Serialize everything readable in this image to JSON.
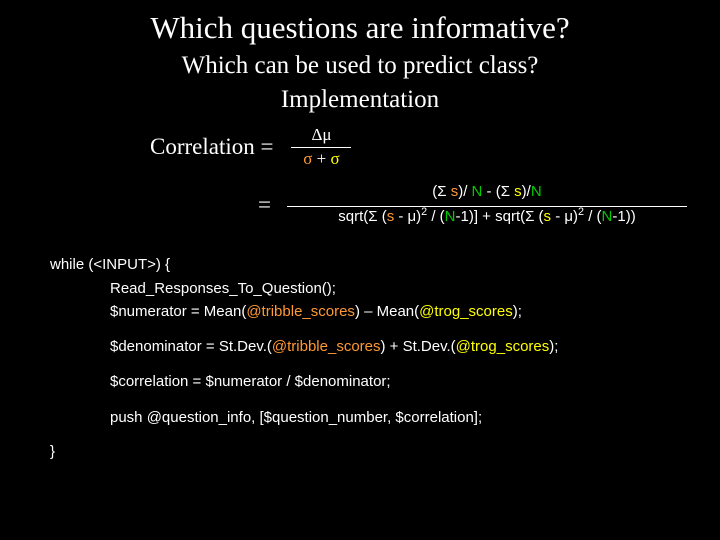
{
  "title": "Which questions are informative?",
  "subtitle": "Which can be used to predict class?",
  "impl": "Implementation",
  "eq1": {
    "lhs": "Correlation =",
    "num": "Δμ",
    "den_sigma1": "σ",
    "den_plus": " + ",
    "den_sigma2": "σ"
  },
  "eq2": {
    "eqsign": "=",
    "num": {
      "a1": "(Σ ",
      "a2": "s",
      "a3": ")/ ",
      "a4": "N",
      "mid": "    -   ",
      "b1": "(Σ ",
      "b2": "s",
      "b3": ")/",
      "b4": "N"
    },
    "den": {
      "p1": "sqrt(Σ (",
      "p2": "s",
      "p3": " -  μ)",
      "p4": "2",
      "p5": " / (",
      "p6": "N",
      "p7": "-1)]  + sqrt(Σ (",
      "p8": "s",
      "p9": " -  μ)",
      "p10": "2",
      "p11": " / (",
      "p12": "N",
      "p13": "-1))"
    }
  },
  "code": {
    "l1": "while (<INPUT>) {",
    "l2": "Read_Responses_To_Question();",
    "l3a": "$numerator = Mean(",
    "l3b": "@tribble_scores",
    "l3c": ") – Mean(",
    "l3d": "@trog_scores",
    "l3e": ");",
    "l4a": "$denominator = St.Dev.(",
    "l4b": "@tribble_scores",
    "l4c": ") + St.Dev.(",
    "l4d": "@trog_scores",
    "l4e": ");",
    "l5": "$correlation = $numerator / $denominator;",
    "l6": "push @question_info, [$question_number, $correlation];",
    "l7": "}"
  }
}
